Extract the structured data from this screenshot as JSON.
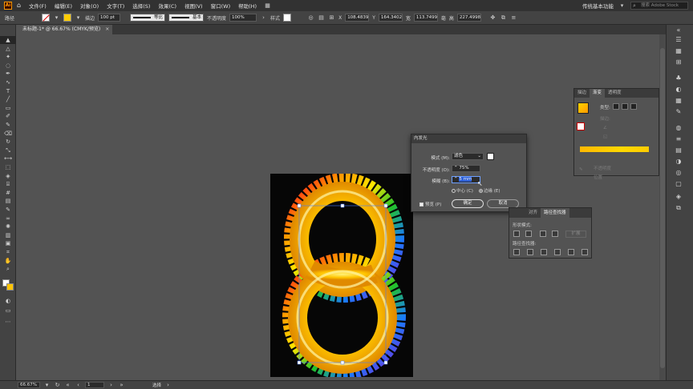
{
  "app": {
    "logo": "Ai",
    "workspace": "传统基本功能",
    "stock_search_placeholder": "搜索 Adobe Stock"
  },
  "menu": [
    "文件(F)",
    "编辑(E)",
    "对象(O)",
    "文字(T)",
    "选择(S)",
    "效果(C)",
    "视图(V)",
    "窗口(W)",
    "帮助(H)"
  ],
  "control_bar": {
    "selection_label": "路径",
    "stroke_label": "描边",
    "stroke_weight": "100 pt",
    "profile_label": "等比",
    "brush_label": "基本",
    "opacity_label": "不透明度",
    "opacity_value": "100%",
    "style_label": "样式",
    "x_label": "X",
    "x_value": "108.4839",
    "y_label": "Y",
    "y_value": "164.3402",
    "w_label": "宽",
    "w_value": "113.7499",
    "w_unit": "毫",
    "h_label": "高",
    "h_value": "227.4998"
  },
  "document": {
    "tab_title": "未标题-1* @ 66.67% (CMYK/预览)",
    "close": "×"
  },
  "status_bar": {
    "zoom": "66.67%",
    "artboard_num": "1",
    "tool_status": "选择"
  },
  "gradient_panel": {
    "tabs": [
      "描边",
      "渐变",
      "透明度"
    ],
    "active_tab": "渐变",
    "type_label": "类型:",
    "stroke_label": "描边:",
    "opacity_label": "不透明度",
    "position_label": "位置"
  },
  "glow_dialog": {
    "title": "内发光",
    "mode_label": "模式 (M):",
    "mode_value": "滤色",
    "opacity_label": "不透明度 (O):",
    "opacity_value": "75%",
    "blur_label": "模糊 (B):",
    "blur_value": "5 mm",
    "center_label": "中心 (C)",
    "edge_label": "边缘 (E)",
    "selected_option": "edge",
    "preview_label": "预览 (P)",
    "ok_label": "确定",
    "cancel_label": "取消"
  },
  "pathfinder_panel": {
    "tabs": [
      "对齐",
      "路径查找器"
    ],
    "active_tab": "路径查找器",
    "shape_modes_label": "形状模式:",
    "pathfinders_label": "路径查找器:",
    "expand_label": "扩展"
  },
  "colors": {
    "accent_gold": "#ffc400",
    "artboard": "#060606",
    "ui_panel": "#535353",
    "ui_dark": "#323232"
  }
}
